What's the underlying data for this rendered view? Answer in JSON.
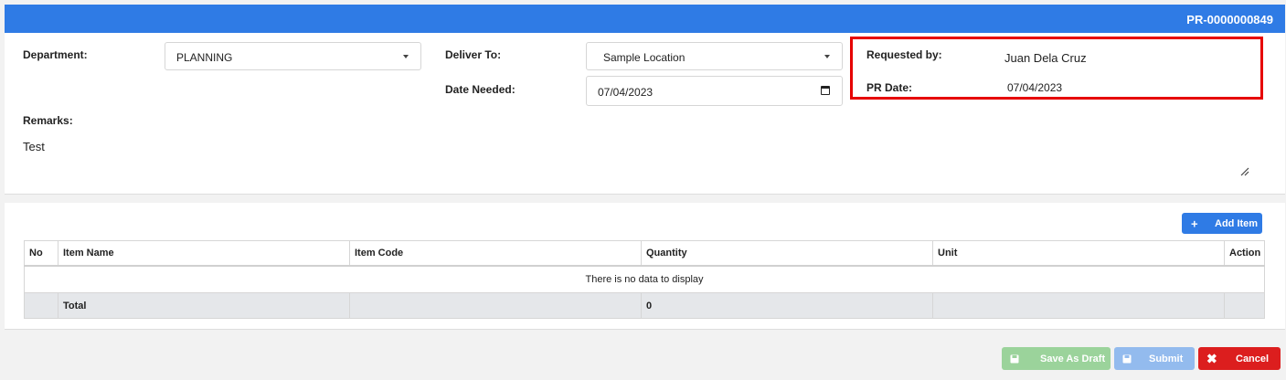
{
  "header": {
    "pr_number": "PR-0000000849"
  },
  "form": {
    "department_label": "Department:",
    "department_value": "PLANNING",
    "deliver_to_label": "Deliver To:",
    "deliver_to_value": "Sample Location",
    "date_needed_label": "Date Needed:",
    "date_needed_value": "07/04/2023",
    "requested_by_label": "Requested by:",
    "requested_by_value": "Juan Dela Cruz",
    "pr_date_label": "PR Date:",
    "pr_date_value": "07/04/2023",
    "remarks_label": "Remarks:",
    "remarks_value": "Test"
  },
  "items": {
    "add_item_label": "Add Item",
    "columns": [
      "No",
      "Item Name",
      "Item Code",
      "Quantity",
      "Unit",
      "Action"
    ],
    "empty_text": "There is no data to display",
    "total_label": "Total",
    "total_quantity": "0"
  },
  "footer": {
    "save_draft_label": "Save As Draft",
    "submit_label": "Submit",
    "cancel_label": "Cancel"
  },
  "colors": {
    "header": "#2f7be5",
    "highlight": "#e60000",
    "draft": "#9bd39b",
    "submit": "#93bbee",
    "cancel": "#dc1e1e"
  }
}
